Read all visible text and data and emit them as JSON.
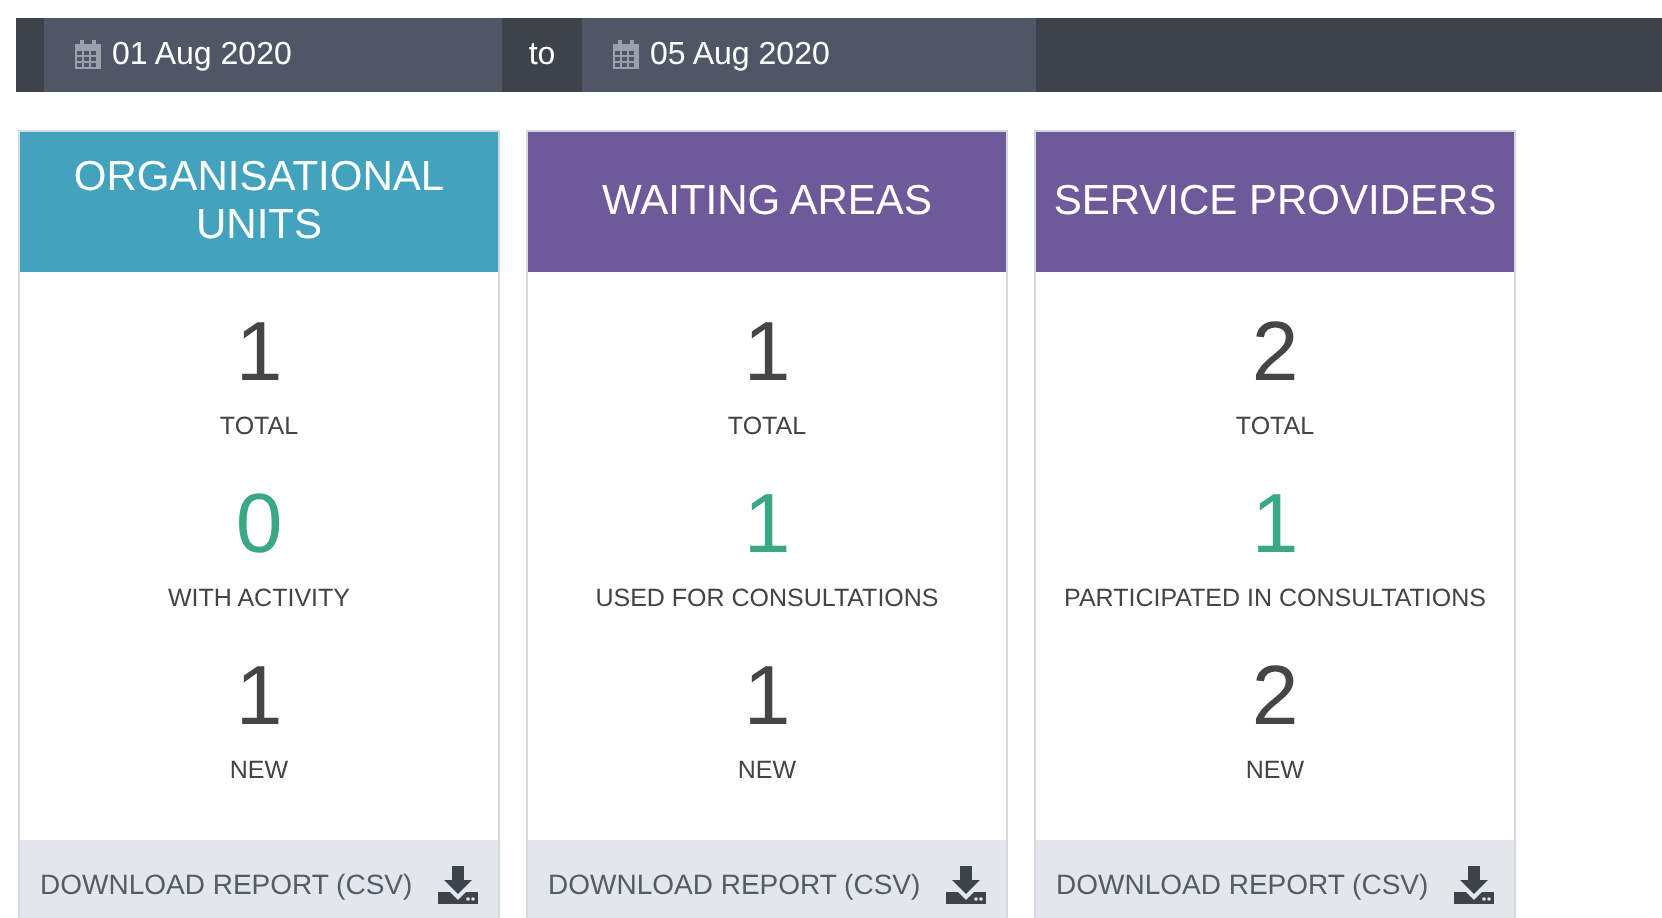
{
  "date_range": {
    "from": "01 Aug 2020",
    "separator": "to",
    "to": "05 Aug 2020"
  },
  "cards": [
    {
      "title": "ORGANISATIONAL UNITS",
      "color": "#43a3bf",
      "stats": [
        {
          "value": "1",
          "label": "TOTAL",
          "highlight": false
        },
        {
          "value": "0",
          "label": "WITH ACTIVITY",
          "highlight": true
        },
        {
          "value": "1",
          "label": "NEW",
          "highlight": false
        }
      ],
      "footer": "DOWNLOAD REPORT (CSV)"
    },
    {
      "title": "WAITING AREAS",
      "color": "#6e5a9a",
      "stats": [
        {
          "value": "1",
          "label": "TOTAL",
          "highlight": false
        },
        {
          "value": "1",
          "label": "USED FOR CONSULTATIONS",
          "highlight": true
        },
        {
          "value": "1",
          "label": "NEW",
          "highlight": false
        }
      ],
      "footer": "DOWNLOAD REPORT (CSV)"
    },
    {
      "title": "SERVICE PROVIDERS",
      "color": "#6e5a9a",
      "stats": [
        {
          "value": "2",
          "label": "TOTAL",
          "highlight": false
        },
        {
          "value": "1",
          "label": "PARTICIPATED IN CONSULTATIONS",
          "highlight": true
        },
        {
          "value": "2",
          "label": "NEW",
          "highlight": false
        }
      ],
      "footer": "DOWNLOAD REPORT (CSV)"
    }
  ]
}
